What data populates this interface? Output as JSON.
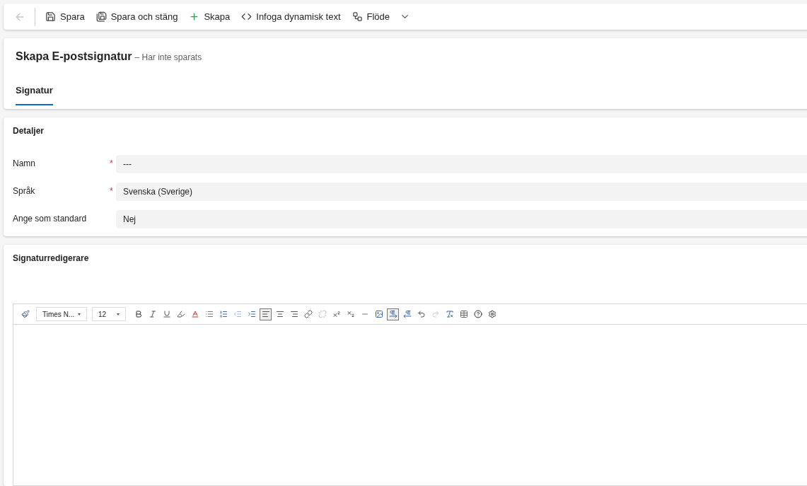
{
  "command_bar": {
    "back_disabled": true,
    "commands": [
      {
        "label": "Spara"
      },
      {
        "label": "Spara och stäng"
      },
      {
        "label": "Skapa"
      },
      {
        "label": "Infoga dynamisk text"
      },
      {
        "label": "Flöde",
        "has_menu": true
      }
    ]
  },
  "header": {
    "title": "Skapa E-postsignatur",
    "status": "– Har inte sparats",
    "tabs": [
      {
        "label": "Signatur",
        "selected": true
      }
    ]
  },
  "details": {
    "title": "Detaljer",
    "fields": [
      {
        "label": "Namn",
        "required_mark": "*",
        "value": "---"
      },
      {
        "label": "Språk",
        "required_mark": "*",
        "value": "Svenska (Sverige)"
      },
      {
        "label": "Ange som standard",
        "value": "Nej"
      }
    ]
  },
  "editor": {
    "title": "Signaturredigerare",
    "font": "Times N...",
    "size": "12",
    "buttons": [
      {
        "pressed": false
      },
      {
        "pressed": false
      },
      {
        "pressed": false
      },
      {
        "pressed": false
      },
      {
        "pressed": false
      },
      {
        "pressed": false
      },
      {
        "pressed": false
      },
      {
        "pressed": false
      },
      {
        "pressed": false
      },
      {
        "pressed": false
      },
      {
        "pressed": true
      },
      {
        "pressed": false
      },
      {
        "pressed": false
      },
      {
        "pressed": false
      },
      {
        "pressed": false
      },
      {
        "pressed": false
      },
      {
        "pressed": false
      },
      {
        "pressed": false
      },
      {
        "pressed": false
      },
      {
        "pressed": true
      },
      {
        "pressed": false
      },
      {
        "pressed": false
      },
      {
        "pressed": false
      },
      {
        "pressed": false
      },
      {
        "pressed": false
      },
      {
        "pressed": false
      },
      {
        "pressed": false
      }
    ]
  }
}
